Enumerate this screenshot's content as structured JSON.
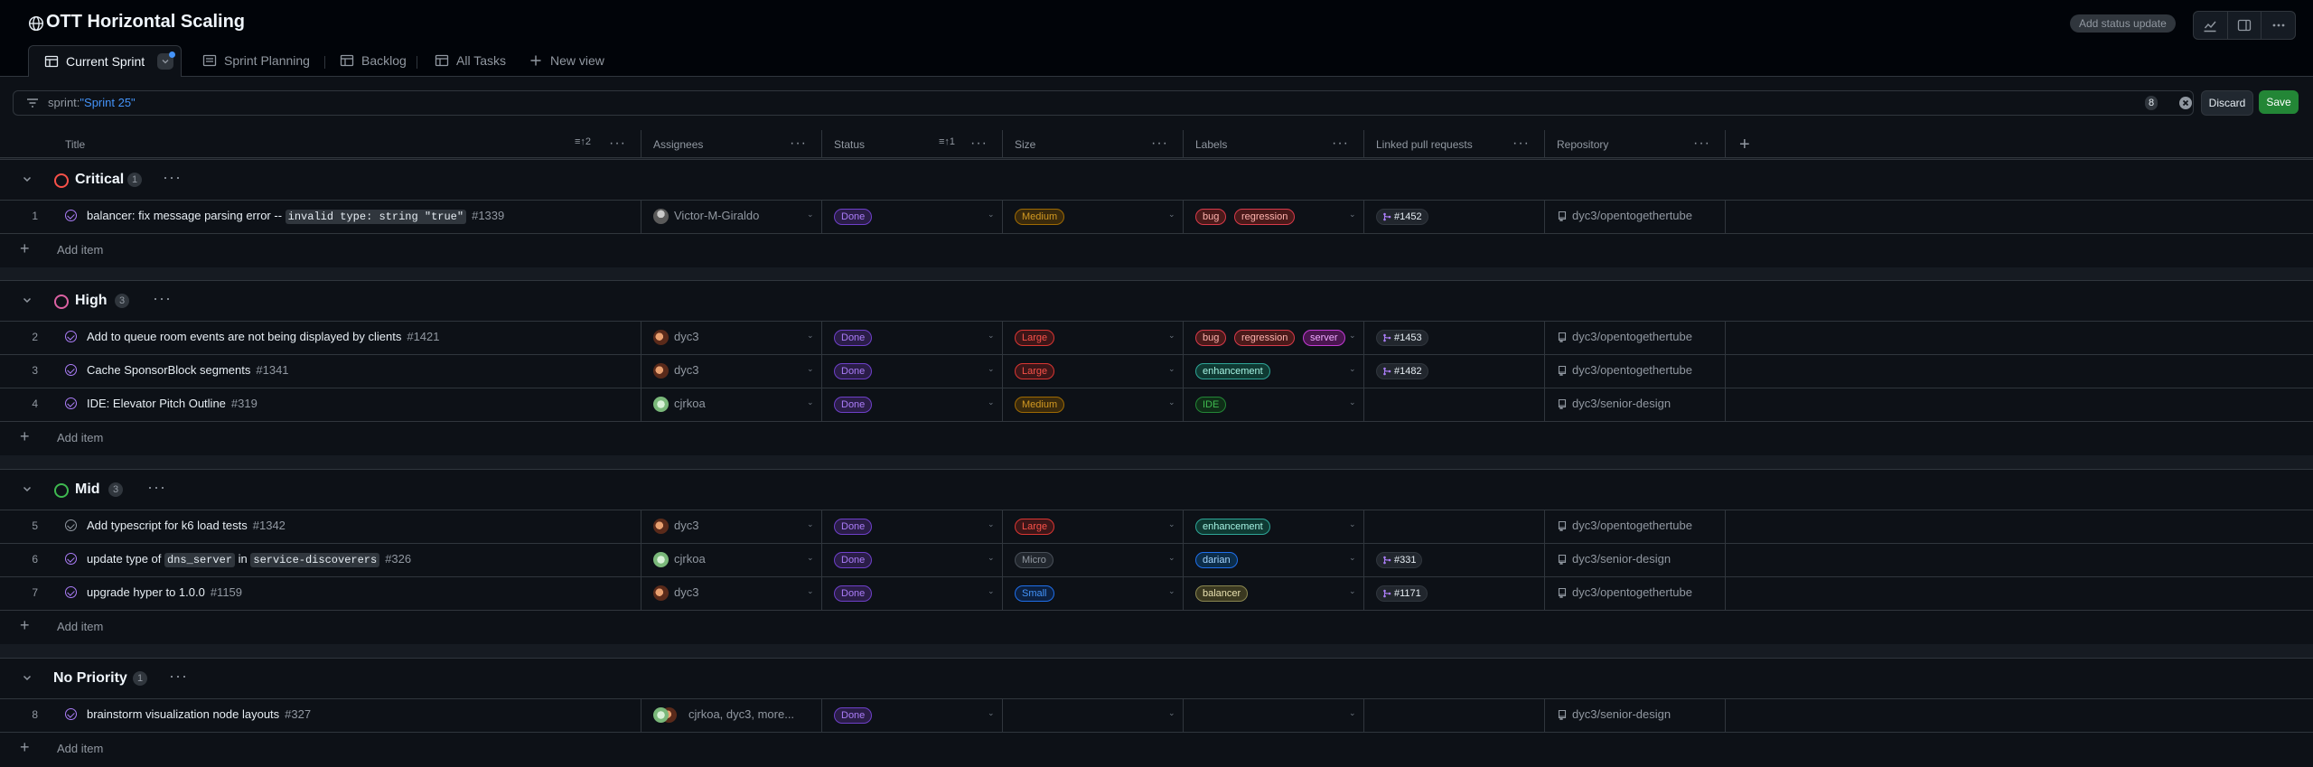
{
  "project": {
    "title": "OTT Horizontal Scaling",
    "add_status": "Add status update"
  },
  "tabs": [
    {
      "label": "Current Sprint",
      "active": true,
      "icon": "table-icon"
    },
    {
      "label": "Sprint Planning",
      "icon": "board-icon"
    },
    {
      "label": "Backlog",
      "icon": "table-icon"
    },
    {
      "label": "All Tasks",
      "icon": "table-icon"
    },
    {
      "label": "New view",
      "icon": "plus-icon"
    }
  ],
  "filter": {
    "prefix": "sprint:",
    "value": "\"Sprint 25\"",
    "count": "8"
  },
  "buttons": {
    "discard": "Discard",
    "save": "Save"
  },
  "columns": {
    "title": "Title",
    "title_sort": "2",
    "assignees": "Assignees",
    "status": "Status",
    "status_sort": "1",
    "size": "Size",
    "labels": "Labels",
    "linked_prs": "Linked pull requests",
    "repository": "Repository"
  },
  "add_item": "Add item",
  "groups": [
    {
      "name": "Critical",
      "count": "1",
      "color": "#f85149"
    },
    {
      "name": "High",
      "count": "3",
      "color": "#db61a2"
    },
    {
      "name": "Mid",
      "count": "3",
      "color": "#3fb950"
    },
    {
      "name": "No Priority",
      "count": "1",
      "color": null
    }
  ],
  "rows": [
    {
      "num": "1",
      "title_parts": [
        "balancer: fix message parsing error -- "
      ],
      "code": "invalid type: string \"true\"",
      "issue": "#1339",
      "assignee": "Victor-M-Giraldo",
      "status": "Done",
      "size": "Medium",
      "labels": [
        "bug",
        "regression"
      ],
      "pr": "#1452",
      "repo": "dyc3/opentogethertube"
    },
    {
      "num": "2",
      "title": "Add to queue room events are not being displayed by clients",
      "issue": "#1421",
      "assignee": "dyc3",
      "status": "Done",
      "size": "Large",
      "labels": [
        "bug",
        "regression",
        "server"
      ],
      "pr": "#1453",
      "repo": "dyc3/opentogethertube"
    },
    {
      "num": "3",
      "title": "Cache SponsorBlock segments",
      "issue": "#1341",
      "assignee": "dyc3",
      "status": "Done",
      "size": "Large",
      "labels": [
        "enhancement"
      ],
      "pr": "#1482",
      "repo": "dyc3/opentogethertube"
    },
    {
      "num": "4",
      "title": "IDE: Elevator Pitch Outline",
      "issue": "#319",
      "assignee": "cjrkoa",
      "status": "Done",
      "size": "Medium",
      "labels": [
        "IDE"
      ],
      "pr": "",
      "repo": "dyc3/senior-design"
    },
    {
      "num": "5",
      "title": "Add typescript for k6 load tests",
      "issue": "#1342",
      "assignee": "dyc3",
      "status": "Done",
      "size": "Large",
      "labels": [
        "enhancement"
      ],
      "pr": "",
      "repo": "dyc3/opentogethertube"
    },
    {
      "num": "6",
      "t1": "update type of ",
      "c1": "dns_server",
      "t2": " in ",
      "c2": "service-discoverers",
      "issue": "#326",
      "assignee": "cjrkoa",
      "status": "Done",
      "size": "Micro",
      "labels": [
        "darian"
      ],
      "pr": "#331",
      "repo": "dyc3/senior-design"
    },
    {
      "num": "7",
      "title": "upgrade hyper to 1.0.0",
      "issue": "#1159",
      "assignee": "dyc3",
      "status": "Done",
      "size": "Small",
      "labels": [
        "balancer"
      ],
      "pr": "#1171",
      "repo": "dyc3/opentogethertube"
    },
    {
      "num": "8",
      "title": "brainstorm visualization node layouts",
      "issue": "#327",
      "assignee": "cjrkoa, dyc3, more...",
      "status": "Done",
      "size": "",
      "labels": [],
      "pr": "",
      "repo": "dyc3/senior-design"
    }
  ]
}
